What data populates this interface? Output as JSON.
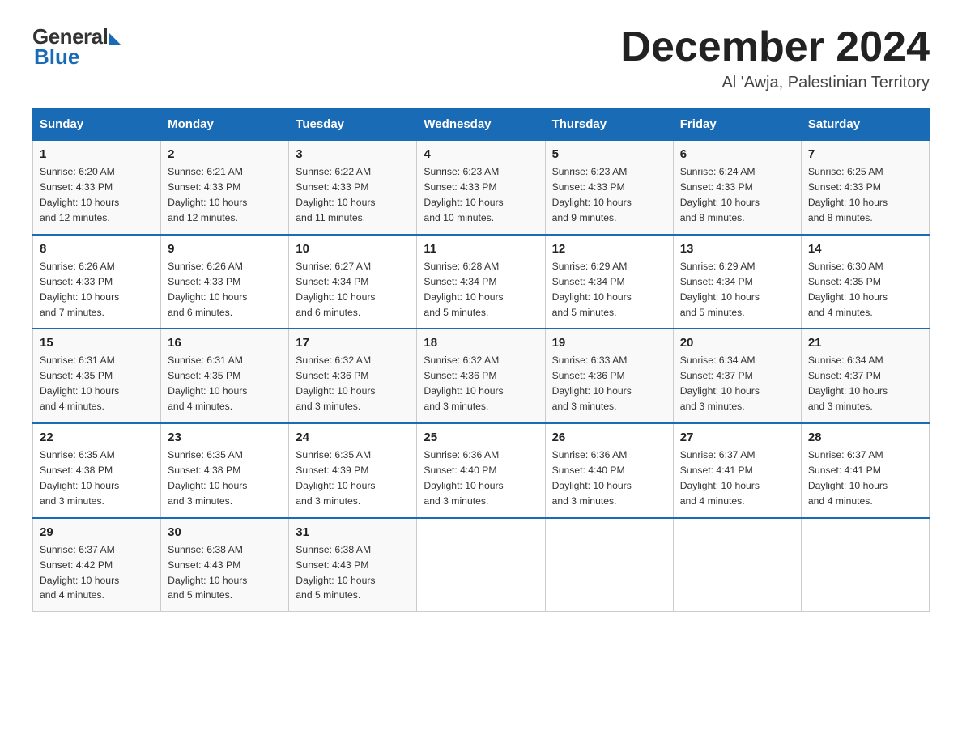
{
  "header": {
    "logo_general": "General",
    "logo_blue": "Blue",
    "month_title": "December 2024",
    "location": "Al 'Awja, Palestinian Territory"
  },
  "days_of_week": [
    "Sunday",
    "Monday",
    "Tuesday",
    "Wednesday",
    "Thursday",
    "Friday",
    "Saturday"
  ],
  "weeks": [
    [
      {
        "day": "1",
        "sunrise": "6:20 AM",
        "sunset": "4:33 PM",
        "daylight": "10 hours and 12 minutes."
      },
      {
        "day": "2",
        "sunrise": "6:21 AM",
        "sunset": "4:33 PM",
        "daylight": "10 hours and 12 minutes."
      },
      {
        "day": "3",
        "sunrise": "6:22 AM",
        "sunset": "4:33 PM",
        "daylight": "10 hours and 11 minutes."
      },
      {
        "day": "4",
        "sunrise": "6:23 AM",
        "sunset": "4:33 PM",
        "daylight": "10 hours and 10 minutes."
      },
      {
        "day": "5",
        "sunrise": "6:23 AM",
        "sunset": "4:33 PM",
        "daylight": "10 hours and 9 minutes."
      },
      {
        "day": "6",
        "sunrise": "6:24 AM",
        "sunset": "4:33 PM",
        "daylight": "10 hours and 8 minutes."
      },
      {
        "day": "7",
        "sunrise": "6:25 AM",
        "sunset": "4:33 PM",
        "daylight": "10 hours and 8 minutes."
      }
    ],
    [
      {
        "day": "8",
        "sunrise": "6:26 AM",
        "sunset": "4:33 PM",
        "daylight": "10 hours and 7 minutes."
      },
      {
        "day": "9",
        "sunrise": "6:26 AM",
        "sunset": "4:33 PM",
        "daylight": "10 hours and 6 minutes."
      },
      {
        "day": "10",
        "sunrise": "6:27 AM",
        "sunset": "4:34 PM",
        "daylight": "10 hours and 6 minutes."
      },
      {
        "day": "11",
        "sunrise": "6:28 AM",
        "sunset": "4:34 PM",
        "daylight": "10 hours and 5 minutes."
      },
      {
        "day": "12",
        "sunrise": "6:29 AM",
        "sunset": "4:34 PM",
        "daylight": "10 hours and 5 minutes."
      },
      {
        "day": "13",
        "sunrise": "6:29 AM",
        "sunset": "4:34 PM",
        "daylight": "10 hours and 5 minutes."
      },
      {
        "day": "14",
        "sunrise": "6:30 AM",
        "sunset": "4:35 PM",
        "daylight": "10 hours and 4 minutes."
      }
    ],
    [
      {
        "day": "15",
        "sunrise": "6:31 AM",
        "sunset": "4:35 PM",
        "daylight": "10 hours and 4 minutes."
      },
      {
        "day": "16",
        "sunrise": "6:31 AM",
        "sunset": "4:35 PM",
        "daylight": "10 hours and 4 minutes."
      },
      {
        "day": "17",
        "sunrise": "6:32 AM",
        "sunset": "4:36 PM",
        "daylight": "10 hours and 3 minutes."
      },
      {
        "day": "18",
        "sunrise": "6:32 AM",
        "sunset": "4:36 PM",
        "daylight": "10 hours and 3 minutes."
      },
      {
        "day": "19",
        "sunrise": "6:33 AM",
        "sunset": "4:36 PM",
        "daylight": "10 hours and 3 minutes."
      },
      {
        "day": "20",
        "sunrise": "6:34 AM",
        "sunset": "4:37 PM",
        "daylight": "10 hours and 3 minutes."
      },
      {
        "day": "21",
        "sunrise": "6:34 AM",
        "sunset": "4:37 PM",
        "daylight": "10 hours and 3 minutes."
      }
    ],
    [
      {
        "day": "22",
        "sunrise": "6:35 AM",
        "sunset": "4:38 PM",
        "daylight": "10 hours and 3 minutes."
      },
      {
        "day": "23",
        "sunrise": "6:35 AM",
        "sunset": "4:38 PM",
        "daylight": "10 hours and 3 minutes."
      },
      {
        "day": "24",
        "sunrise": "6:35 AM",
        "sunset": "4:39 PM",
        "daylight": "10 hours and 3 minutes."
      },
      {
        "day": "25",
        "sunrise": "6:36 AM",
        "sunset": "4:40 PM",
        "daylight": "10 hours and 3 minutes."
      },
      {
        "day": "26",
        "sunrise": "6:36 AM",
        "sunset": "4:40 PM",
        "daylight": "10 hours and 3 minutes."
      },
      {
        "day": "27",
        "sunrise": "6:37 AM",
        "sunset": "4:41 PM",
        "daylight": "10 hours and 4 minutes."
      },
      {
        "day": "28",
        "sunrise": "6:37 AM",
        "sunset": "4:41 PM",
        "daylight": "10 hours and 4 minutes."
      }
    ],
    [
      {
        "day": "29",
        "sunrise": "6:37 AM",
        "sunset": "4:42 PM",
        "daylight": "10 hours and 4 minutes."
      },
      {
        "day": "30",
        "sunrise": "6:38 AM",
        "sunset": "4:43 PM",
        "daylight": "10 hours and 5 minutes."
      },
      {
        "day": "31",
        "sunrise": "6:38 AM",
        "sunset": "4:43 PM",
        "daylight": "10 hours and 5 minutes."
      },
      null,
      null,
      null,
      null
    ]
  ],
  "labels": {
    "sunrise": "Sunrise:",
    "sunset": "Sunset:",
    "daylight": "Daylight:"
  }
}
